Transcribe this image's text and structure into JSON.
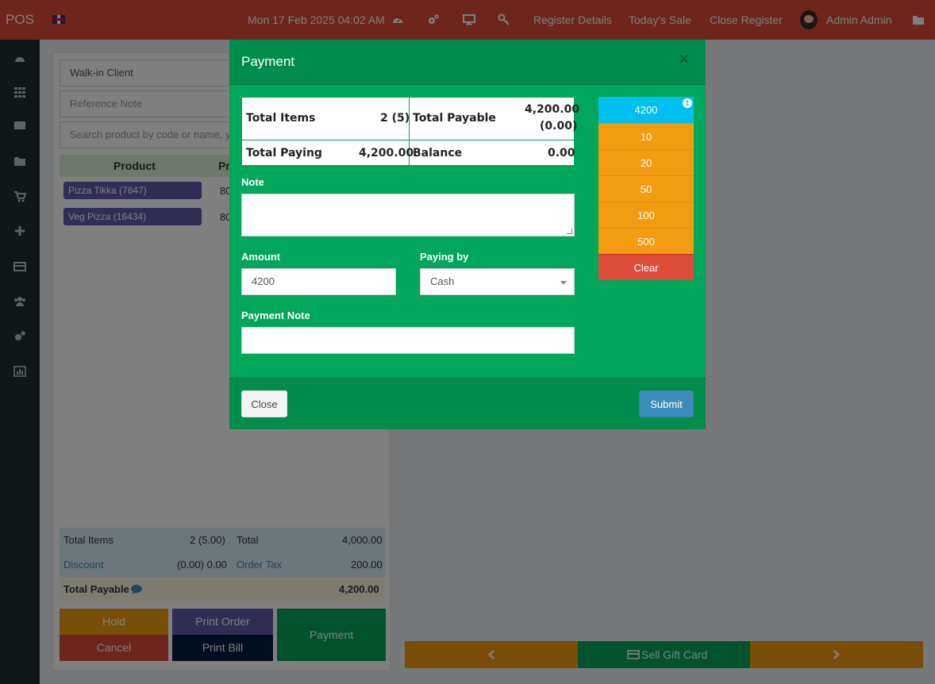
{
  "topbar": {
    "logo": "POS",
    "datetime": "Mon 17 Feb 2025 04:02 AM",
    "register_details": "Register Details",
    "todays_sale": "Today's Sale",
    "close_register": "Close Register",
    "user_name": "Admin Admin"
  },
  "pos": {
    "customer": "Walk-in Client",
    "reference_placeholder": "Reference Note",
    "search_placeholder": "Search product by code or name, y",
    "table_headers": [
      "Product",
      "Pr"
    ],
    "items": [
      {
        "name": "Pizza Tikka (7847)",
        "price": "80"
      },
      {
        "name": "Veg Pizza (16434)",
        "price": "80"
      }
    ],
    "totals": {
      "total_items_label": "Total Items",
      "total_items_value": "2 (5.00)",
      "total_label": "Total",
      "total_value": "4,000.00",
      "discount_label": "Discount",
      "discount_value": "(0.00) 0.00",
      "order_tax_label": "Order Tax",
      "order_tax_value": "200.00",
      "total_payable_label": "Total Payable",
      "total_payable_value": "4,200.00"
    },
    "buttons": {
      "hold": "Hold",
      "cancel": "Cancel",
      "print_order": "Print Order",
      "print_bill": "Print Bill",
      "payment": "Payment"
    }
  },
  "gift_bar": {
    "sell_gift_card": "Sell Gift Card"
  },
  "modal": {
    "title": "Payment",
    "close_x": "×",
    "summary": {
      "total_items_label": "Total Items",
      "total_items_value": "2 (5)",
      "total_payable_label": "Total Payable",
      "total_payable_value": "4,200.00",
      "total_payable_sub": "(0.00)",
      "total_paying_label": "Total Paying",
      "total_paying_value": "4,200.00",
      "balance_label": "Balance",
      "balance_value": "0.00"
    },
    "note_label": "Note",
    "amount_label": "Amount",
    "amount_value": "4200",
    "paying_by_label": "Paying by",
    "paying_by_value": "Cash",
    "payment_note_label": "Payment Note",
    "quick_cash": [
      "4200",
      "10",
      "20",
      "50",
      "100",
      "500"
    ],
    "quick_badge": "1",
    "clear_label": "Clear",
    "close_button": "Close",
    "submit_button": "Submit"
  },
  "colors": {
    "topbar": "#dd4b39",
    "sidebar": "#222d32",
    "modal": "#00a65a",
    "modal_dark": "#008d4c",
    "quick_primary": "#00c0ef",
    "quick_cash": "#f39c12",
    "clear": "#dd4b39",
    "submit": "#3c8dbc"
  }
}
